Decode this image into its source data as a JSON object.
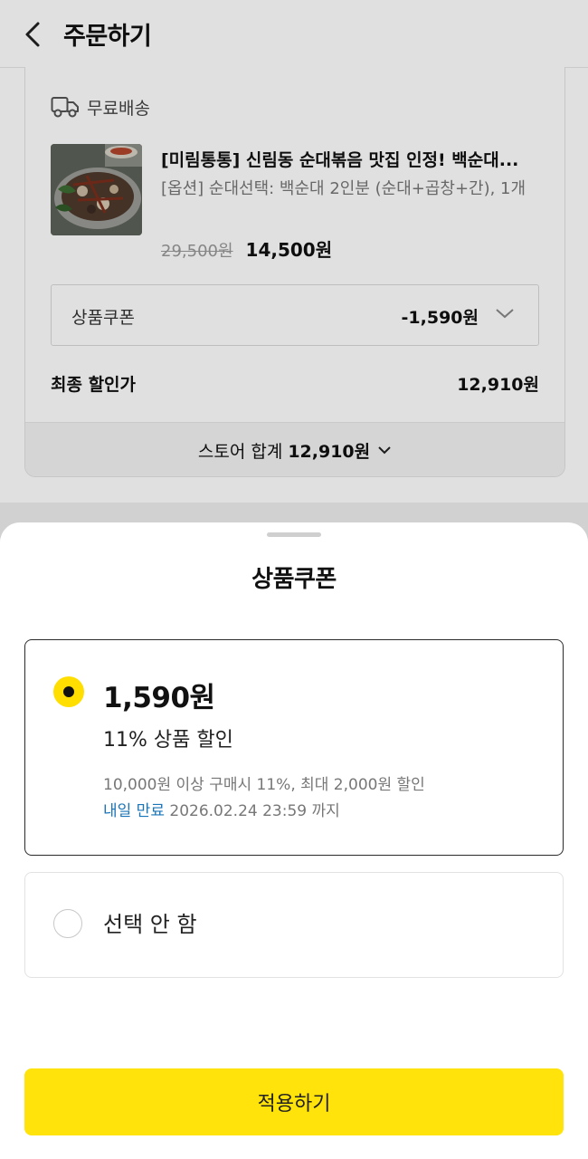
{
  "header": {
    "title": "주문하기"
  },
  "order": {
    "shipping_label": "무료배송",
    "product_title": "[미림통통] 신림동 순대볶음 맛집 인정! 백순대...",
    "product_option": "[옵션] 순대선택: 백순대 2인분 (순대+곱창+간), 1개",
    "original_price": "29,500원",
    "sale_price": "14,500원",
    "coupon_label": "상품쿠폰",
    "coupon_value": "-1,590원",
    "final_label": "최종 할인가",
    "final_value": "12,910원",
    "store_total_label": "스토어 합계",
    "store_total_value": "12,910원"
  },
  "sheet": {
    "title": "상품쿠폰",
    "coupon": {
      "amount": "1,590원",
      "name": "11% 상품 할인",
      "condition": "10,000원 이상 구매시 11%, 최대 2,000원 할인",
      "expiry_highlight": "내일 만료",
      "expiry_date": "2026.02.24 23:59 까지"
    },
    "none_label": "선택 안 함",
    "apply_label": "적용하기"
  },
  "colors": {
    "accent_yellow": "#ffe30a",
    "radio_yellow": "#ffde00",
    "expiry_blue": "#1a75b8"
  }
}
